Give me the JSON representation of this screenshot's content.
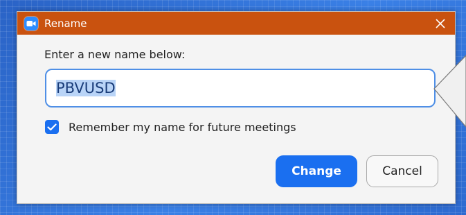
{
  "dialog": {
    "title": "Rename",
    "app_icon": "video-camera-icon",
    "close_icon": "close-icon",
    "prompt": "Enter a new name below:",
    "name_input": {
      "value": "PBVUSD",
      "selected": true
    },
    "remember_checkbox": {
      "checked": true,
      "label": "Remember my name for future meetings"
    },
    "primary_button": "Change",
    "secondary_button": "Cancel"
  },
  "colors": {
    "titlebar": "#c9520f",
    "primary": "#1a6ff0",
    "input_border": "#4f8fe6",
    "selection": "#b9d4f7",
    "desktop": "#2f6fd4"
  }
}
